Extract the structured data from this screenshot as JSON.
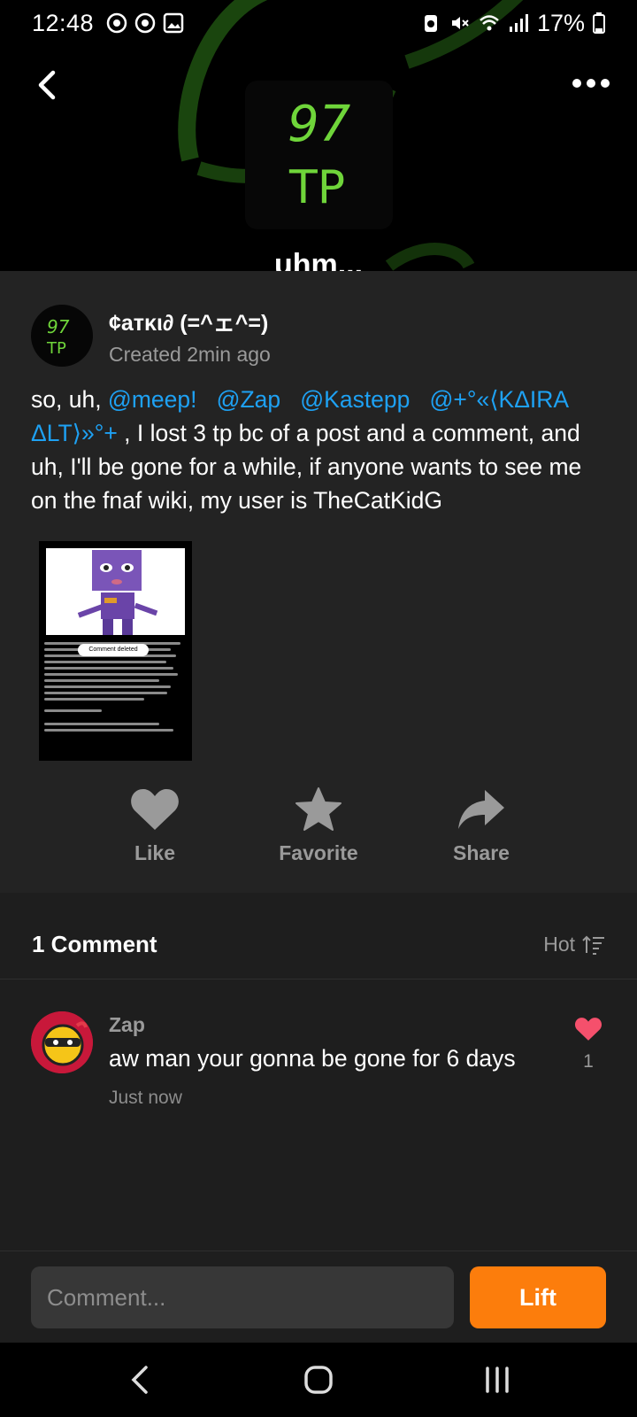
{
  "status_bar": {
    "time": "12:48",
    "battery": "17%"
  },
  "header": {
    "cover_text_line1": "97",
    "cover_text_line2": "TP",
    "title": "uhm..."
  },
  "post": {
    "author_name": "¢атκι∂ (=^ェ^=)",
    "created": "Created 2min ago",
    "avatar_text_line1": "97",
    "avatar_text_line2": "TP",
    "body": {
      "intro": "so, uh, ",
      "mentions": [
        "@meep!",
        "@Zap",
        "@Kastepp",
        "@+°«⟨KΔIRA ΔLT⟩»°+"
      ],
      "text": " , I lost 3 tp bc of a post and a comment, and uh, I'll be gone for a while, if anyone wants to see me on the fnaf wiki, my user is TheCatKidG"
    },
    "image_overlay_label": "Comment deleted",
    "actions": {
      "like": "Like",
      "favorite": "Favorite",
      "share": "Share"
    }
  },
  "comments": {
    "title": "1 Comment",
    "sort_label": "Hot",
    "items": [
      {
        "author": "Zap",
        "text": "aw man your gonna be gone for 6 days",
        "time": "Just now",
        "likes": "1"
      }
    ]
  },
  "composer": {
    "placeholder": "Comment...",
    "submit_label": "Lift"
  },
  "colors": {
    "accent_orange": "#fc7d0c",
    "mention_blue": "#1ea1f3",
    "like_pink": "#f5506c",
    "cover_green": "#6fd53a"
  }
}
